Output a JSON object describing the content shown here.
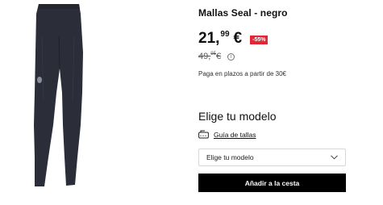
{
  "product": {
    "title": "Mallas Seal - negro",
    "image_alt": "black leggings",
    "image_icon": "leggings-image"
  },
  "pricing": {
    "price_integer": "21,",
    "price_decimal": "99",
    "currency": "€",
    "discount_badge": "-55%",
    "old_price_integer": "49,",
    "old_price_decimal": "95",
    "old_currency": "€",
    "info_icon": "i",
    "installments": "Paga en plazos a partir de 30€"
  },
  "model": {
    "heading": "Elige tu modelo",
    "size_guide_icon": "size-guide-icon",
    "size_guide_label": "Guía de tallas",
    "select_value": "Elige tu modelo",
    "add_to_cart": "Añadir a la cesta"
  },
  "colors": {
    "discount": "#e42535",
    "button": "#000000",
    "garment": "#2b2e38"
  }
}
